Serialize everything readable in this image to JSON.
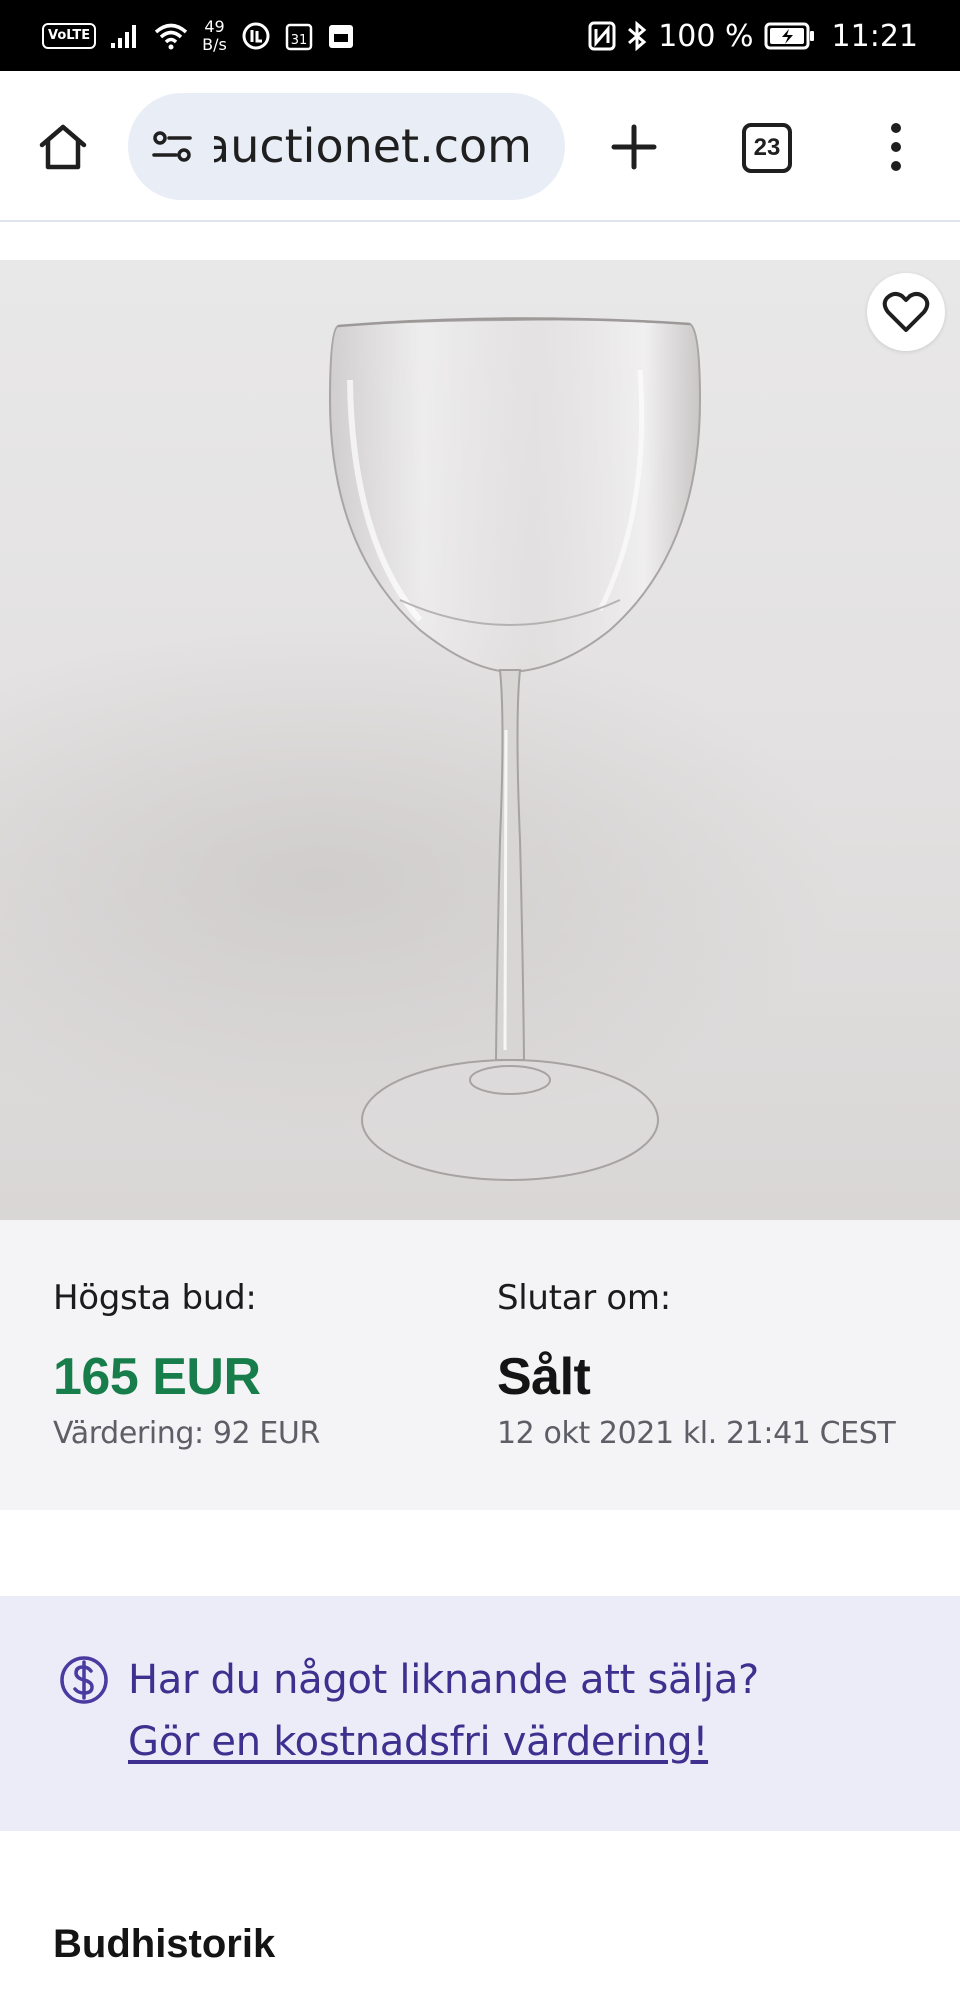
{
  "status_bar": {
    "volte": "VoLTE",
    "net_speed_value": "49",
    "net_speed_unit": "B/s",
    "calendar_date": "31",
    "battery_percent": "100 %",
    "time": "11:21"
  },
  "browser": {
    "url": "auctionet.com",
    "tab_count": "23"
  },
  "product": {
    "image_count": 3,
    "active_image_index": 0
  },
  "bid_info": {
    "highest_bid_label": "Högsta bud:",
    "highest_bid_value": "165 EUR",
    "valuation": "Värdering: 92 EUR",
    "ends_label": "Slutar om:",
    "status_value": "Sålt",
    "end_date": "12 okt 2021 kl. 21:41 CEST"
  },
  "sell_banner": {
    "question": "Har du något liknande att sälja?",
    "link_text": "Gör en kostnadsfri värdering!"
  },
  "bid_history": {
    "title": "Budhistorik"
  },
  "colors": {
    "bid_green": "#177d4a",
    "banner_bg": "#ecebf8",
    "banner_text": "#3f2f8e",
    "info_bg": "#f4f4f6"
  }
}
